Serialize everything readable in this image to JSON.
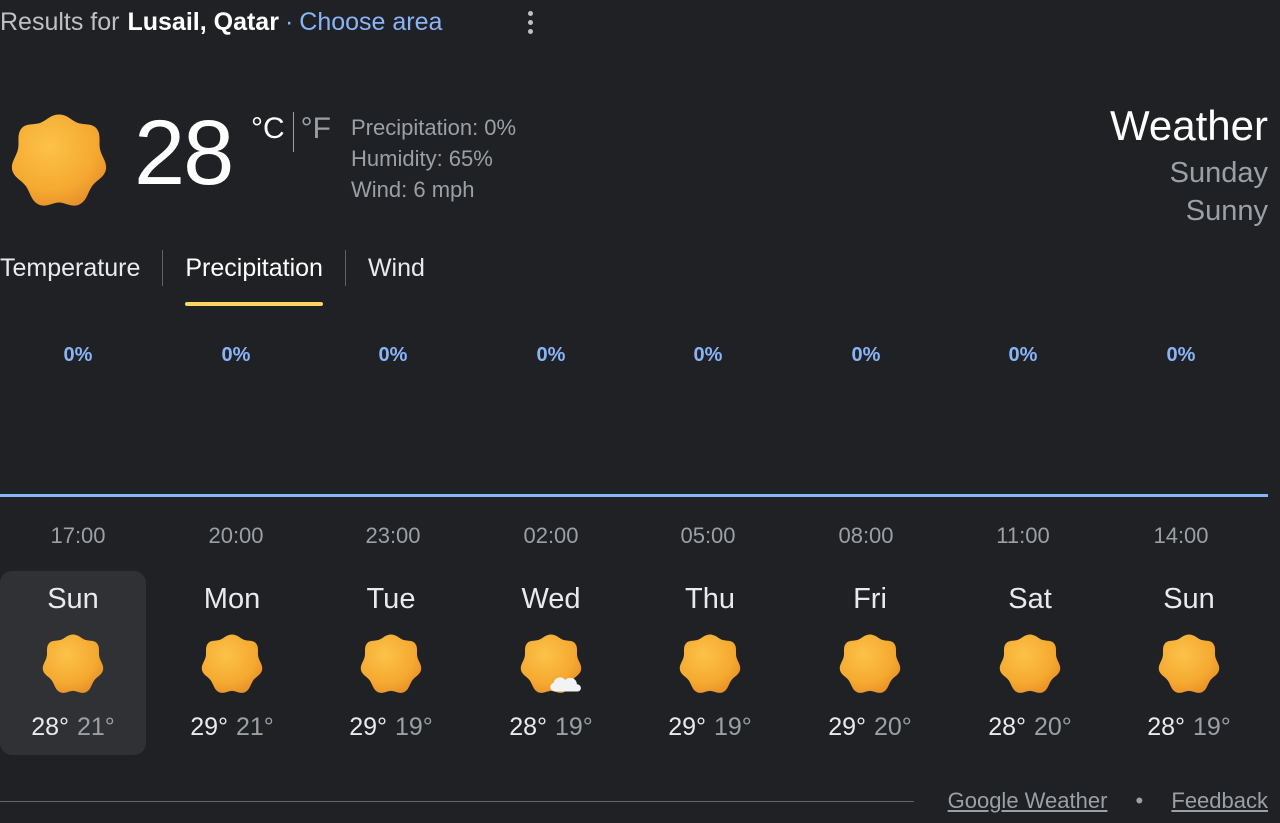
{
  "header": {
    "prefix": "Results for",
    "location": "Lusail, Qatar",
    "separator": "·",
    "choose_area": "Choose area"
  },
  "current": {
    "temperature": "28",
    "unit_c": "°C",
    "unit_f": "°F",
    "precipitation": "Precipitation: 0%",
    "humidity": "Humidity: 65%",
    "wind": "Wind: 6 mph",
    "icon": "sunny-icon"
  },
  "summary": {
    "title": "Weather",
    "day": "Sunday",
    "condition": "Sunny"
  },
  "tabs": [
    {
      "label": "Temperature",
      "active": false
    },
    {
      "label": "Precipitation",
      "active": true
    },
    {
      "label": "Wind",
      "active": false
    }
  ],
  "hourly": {
    "precip": [
      "0%",
      "0%",
      "0%",
      "0%",
      "0%",
      "0%",
      "0%",
      "0%"
    ],
    "times": [
      "17:00",
      "20:00",
      "23:00",
      "02:00",
      "05:00",
      "08:00",
      "11:00",
      "14:00"
    ]
  },
  "days": [
    {
      "name": "Sun",
      "hi": "28°",
      "lo": "21°",
      "icon": "sunny-icon",
      "selected": true
    },
    {
      "name": "Mon",
      "hi": "29°",
      "lo": "21°",
      "icon": "sunny-icon",
      "selected": false
    },
    {
      "name": "Tue",
      "hi": "29°",
      "lo": "19°",
      "icon": "sunny-icon",
      "selected": false
    },
    {
      "name": "Wed",
      "hi": "28°",
      "lo": "19°",
      "icon": "mostly-sunny-icon",
      "selected": false
    },
    {
      "name": "Thu",
      "hi": "29°",
      "lo": "19°",
      "icon": "sunny-icon",
      "selected": false
    },
    {
      "name": "Fri",
      "hi": "29°",
      "lo": "20°",
      "icon": "sunny-icon",
      "selected": false
    },
    {
      "name": "Sat",
      "hi": "28°",
      "lo": "20°",
      "icon": "sunny-icon",
      "selected": false
    },
    {
      "name": "Sun",
      "hi": "28°",
      "lo": "19°",
      "icon": "sunny-icon",
      "selected": false
    }
  ],
  "footer": {
    "source": "Google Weather",
    "bullet": "•",
    "feedback": "Feedback"
  },
  "colors": {
    "background": "#202124",
    "accent_blue": "#8ab4f8",
    "tab_underline": "#fdd663",
    "sun_orange": "#f6a623"
  }
}
